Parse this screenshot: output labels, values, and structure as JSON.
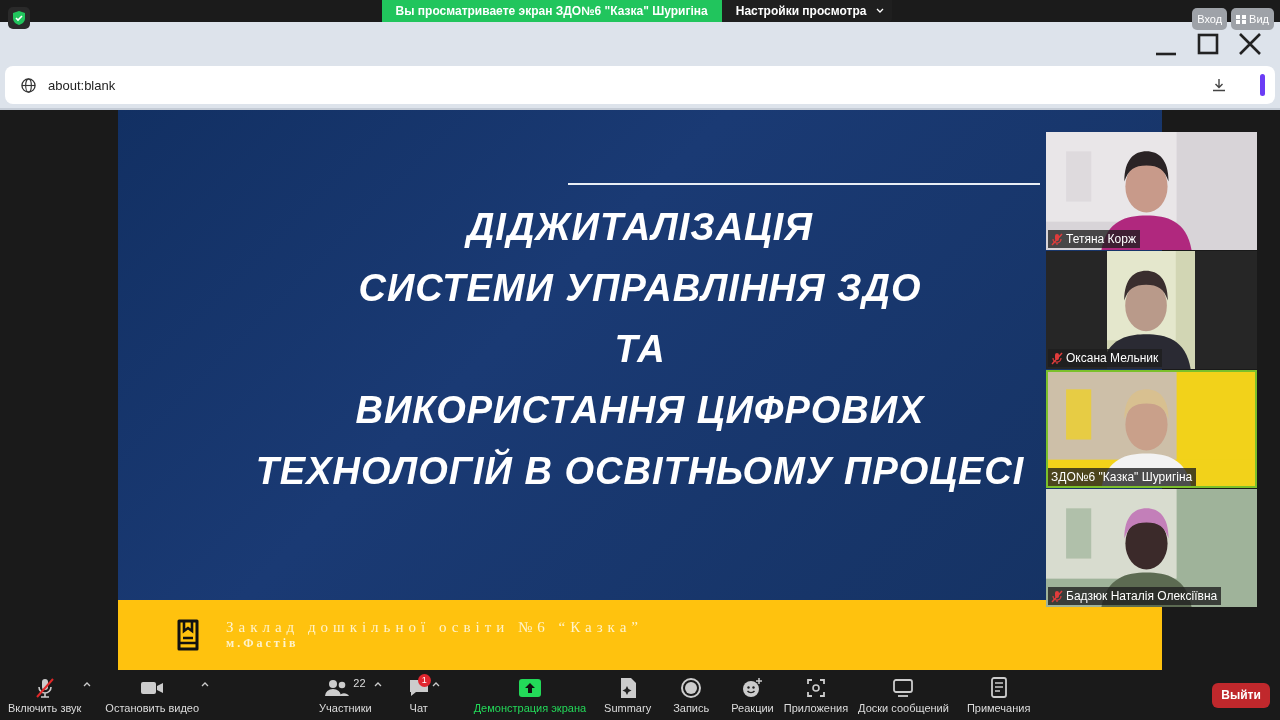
{
  "share_banner": {
    "text": "Вы просматриваете экран ЗДО№6 \"Казка\" Шуригіна",
    "menu": "Настройки просмотра"
  },
  "top_buttons": [
    "Вход",
    "Вид"
  ],
  "browser": {
    "address": "about:blank"
  },
  "slide": {
    "title_lines": [
      "ДІДЖИТАЛІЗАЦІЯ",
      "СИСТЕМИ УПРАВЛІННЯ ЗДО",
      "ТА",
      "ВИКОРИСТАННЯ ЦИФРОВИХ",
      "ТЕХНОЛОГІЙ В ОСВІТНЬОМУ ПРОЦЕСІ"
    ],
    "org": "Заклад дошкільної освіти №6 “Казка”",
    "city": "м.Фастів"
  },
  "participants": [
    {
      "name": "Тетяна Корж",
      "muted": true,
      "speaking": false,
      "kind": "wide"
    },
    {
      "name": "Оксана Мельник",
      "muted": true,
      "speaking": false,
      "kind": "narrow"
    },
    {
      "name": "ЗДО№6 \"Казка\" Шуригіна",
      "muted": false,
      "speaking": true,
      "kind": "wide"
    },
    {
      "name": "Бадзюк Наталія Олексіївна",
      "muted": true,
      "speaking": false,
      "kind": "wide"
    }
  ],
  "toolbar": [
    {
      "kind": "mic",
      "label": "Включить звук",
      "muted": true,
      "caret": true
    },
    {
      "kind": "video",
      "label": "Остановить видео",
      "caret": true
    },
    {
      "kind": "participants",
      "label": "Участники",
      "count": "22",
      "caret": true
    },
    {
      "kind": "chat",
      "label": "Чат",
      "badge": "1",
      "caret": true
    },
    {
      "kind": "share",
      "label": "Демонстрация экрана"
    },
    {
      "kind": "summary",
      "label": "Summary"
    },
    {
      "kind": "record",
      "label": "Запись"
    },
    {
      "kind": "reactions",
      "label": "Реакции"
    },
    {
      "kind": "apps",
      "label": "Приложения"
    },
    {
      "kind": "boards",
      "label": "Доски сообщений"
    },
    {
      "kind": "notes",
      "label": "Примечания"
    }
  ],
  "leave_button": "Выйти"
}
